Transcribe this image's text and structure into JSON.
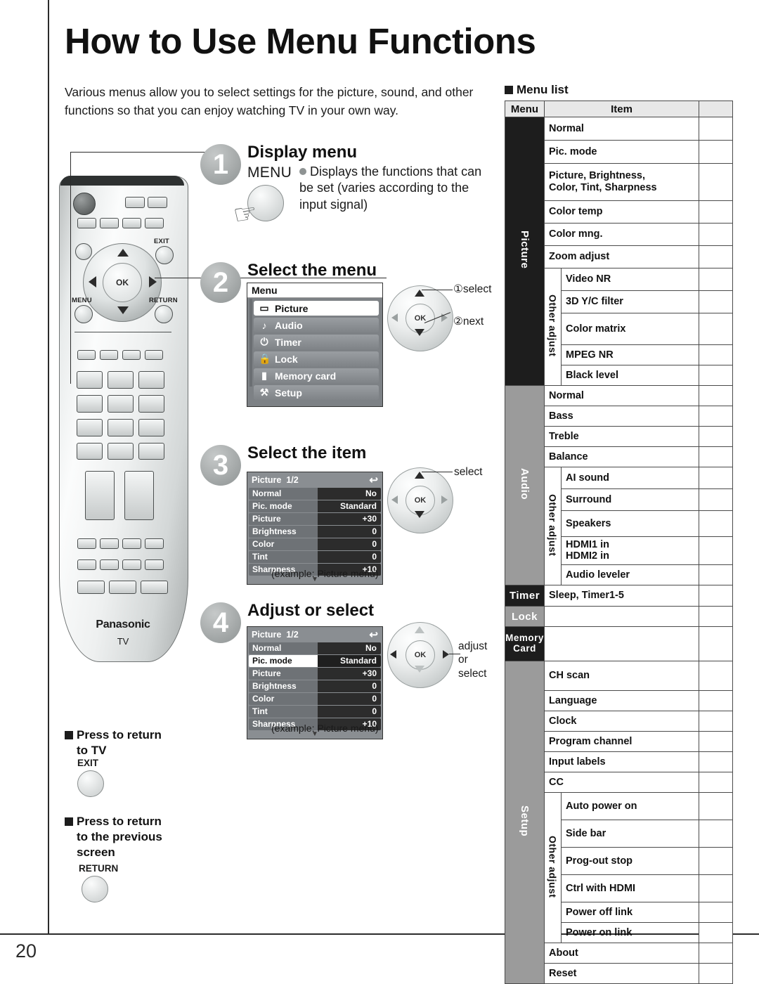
{
  "page": {
    "title": "How to Use Menu Functions",
    "number": "20",
    "intro": "Various menus allow you to select settings for the picture, sound, and other functions so that you can enjoy watching TV in your own way."
  },
  "remote": {
    "brand": "Panasonic",
    "brand_sub": "TV",
    "labels": {
      "exit": "EXIT",
      "menu": "MENU",
      "return": "RETURN"
    }
  },
  "steps": [
    {
      "number": "1",
      "heading": "Display menu",
      "button_word": "MENU",
      "description": "Displays the functions that can be set (varies according to the input signal)"
    },
    {
      "number": "2",
      "heading": "Select the menu",
      "callout_1": "①select",
      "callout_2": "②next",
      "ok_label": "OK"
    },
    {
      "number": "3",
      "heading": "Select the item",
      "callout": "select",
      "caption": "(example: Picture menu)",
      "ok_label": "OK"
    },
    {
      "number": "4",
      "heading": "Adjust or select",
      "callout": "adjust\nor\nselect",
      "callout_line1": "adjust",
      "callout_line2": "or",
      "callout_line3": "select",
      "caption": "(example: Picture menu)",
      "ok_label": "OK"
    }
  ],
  "osd_menu": {
    "header": "Menu",
    "items": [
      {
        "icon": "picture-icon",
        "glyph": "▭",
        "label": "Picture",
        "selected": true
      },
      {
        "icon": "audio-note-icon",
        "glyph": "♪",
        "label": "Audio",
        "selected": false
      },
      {
        "icon": "timer-power-icon",
        "glyph": "⏻",
        "label": "Timer",
        "selected": false
      },
      {
        "icon": "lock-padlock-icon",
        "glyph": "ὑ2",
        "label": "Lock",
        "selected": false
      },
      {
        "icon": "memory-card-icon",
        "glyph": "▮",
        "label": "Memory card",
        "selected": false
      },
      {
        "icon": "setup-wrench-icon",
        "glyph": "⚒",
        "label": "Setup",
        "selected": false
      }
    ]
  },
  "osd_picture_step3": {
    "title": "Picture",
    "page_indicator": "1/2",
    "rows": [
      {
        "label": "Normal",
        "value": "No",
        "selected": false
      },
      {
        "label": "Pic. mode",
        "value": "Standard",
        "selected": false
      },
      {
        "label": "Picture",
        "value": "+30",
        "selected": false
      },
      {
        "label": "Brightness",
        "value": "0",
        "selected": false
      },
      {
        "label": "Color",
        "value": "0",
        "selected": false
      },
      {
        "label": "Tint",
        "value": "0",
        "selected": false
      },
      {
        "label": "Sharpness",
        "value": "+10",
        "selected": false
      }
    ]
  },
  "osd_picture_step4": {
    "title": "Picture",
    "page_indicator": "1/2",
    "rows": [
      {
        "label": "Normal",
        "value": "No",
        "selected": false
      },
      {
        "label": "Pic. mode",
        "value": "Standard",
        "selected": true
      },
      {
        "label": "Picture",
        "value": "+30",
        "selected": false
      },
      {
        "label": "Brightness",
        "value": "0",
        "selected": false
      },
      {
        "label": "Color",
        "value": "0",
        "selected": false
      },
      {
        "label": "Tint",
        "value": "0",
        "selected": false
      },
      {
        "label": "Sharpness",
        "value": "+10",
        "selected": false
      }
    ]
  },
  "notes": [
    {
      "heading": "Press to return\nto TV",
      "heading_l1": "Press to return",
      "heading_l2": "to TV",
      "button_label": "EXIT"
    },
    {
      "heading": "Press to return to the previous screen",
      "heading_l1": "Press to return",
      "heading_l2": "to the previous",
      "heading_l3": "screen",
      "button_label": "RETURN"
    }
  ],
  "menu_list": {
    "section_title": "Menu list",
    "columns": [
      "Menu",
      "Item",
      ""
    ],
    "groups": [
      {
        "name": "Picture",
        "style": "dark",
        "rows": [
          {
            "item": "Normal",
            "sub": null
          },
          {
            "item": "Pic. mode",
            "sub": null
          },
          {
            "item": "Picture, Brightness,\nColor, Tint, Sharpness",
            "sub": null
          },
          {
            "item": "Color temp",
            "sub": null
          },
          {
            "item": "Color mng.",
            "sub": null
          },
          {
            "item": "Zoom adjust",
            "sub": null
          },
          {
            "item": "Video NR",
            "sub": "Other adjust"
          },
          {
            "item": "3D Y/C filter",
            "sub": "Other adjust"
          },
          {
            "item": "Color matrix",
            "sub": "Other adjust"
          },
          {
            "item": "MPEG NR",
            "sub": "Other adjust"
          },
          {
            "item": "Black level",
            "sub": "Other adjust"
          }
        ]
      },
      {
        "name": "Audio",
        "style": "grey",
        "rows": [
          {
            "item": "Normal",
            "sub": null
          },
          {
            "item": "Bass",
            "sub": null
          },
          {
            "item": "Treble",
            "sub": null
          },
          {
            "item": "Balance",
            "sub": null
          },
          {
            "item": "AI sound",
            "sub": "Other adjust"
          },
          {
            "item": "Surround",
            "sub": "Other adjust"
          },
          {
            "item": "Speakers",
            "sub": "Other adjust"
          },
          {
            "item": "HDMI1 in\nHDMI2 in",
            "sub": "Other adjust"
          },
          {
            "item": "Audio leveler",
            "sub": "Other adjust"
          }
        ]
      },
      {
        "name": "Timer",
        "style": "dark",
        "rows": [
          {
            "item": "Sleep, Timer1-5",
            "sub": null
          }
        ]
      },
      {
        "name": "Lock",
        "style": "grey",
        "rows": [
          {
            "item": "",
            "sub": null
          }
        ]
      },
      {
        "name": "Memory\nCard",
        "style": "dark",
        "rows": [
          {
            "item": "",
            "sub": null
          }
        ]
      },
      {
        "name": "Setup",
        "style": "grey",
        "rows": [
          {
            "item": "CH scan",
            "sub": null
          },
          {
            "item": "Language",
            "sub": null
          },
          {
            "item": "Clock",
            "sub": null
          },
          {
            "item": "Program channel",
            "sub": null
          },
          {
            "item": "Input labels",
            "sub": null
          },
          {
            "item": "CC",
            "sub": null
          },
          {
            "item": "Auto power on",
            "sub": "Other adjust"
          },
          {
            "item": "Side bar",
            "sub": "Other adjust"
          },
          {
            "item": "Prog-out stop",
            "sub": "Other adjust"
          },
          {
            "item": "Ctrl with HDMI",
            "sub": "Other adjust"
          },
          {
            "item": "Power off link",
            "sub": "Other adjust"
          },
          {
            "item": "Power on link",
            "sub": "Other adjust"
          },
          {
            "item": "About",
            "sub": null
          },
          {
            "item": "Reset",
            "sub": null
          }
        ]
      }
    ]
  },
  "colors": {
    "ink": "#1a1a1a",
    "dark_cat": "#1d1d1d",
    "grey_cat": "#9b9b9b",
    "header_bg": "#e8e8e8",
    "osd_panel": "#7d8185",
    "osd_value": "#2c2c2c"
  }
}
